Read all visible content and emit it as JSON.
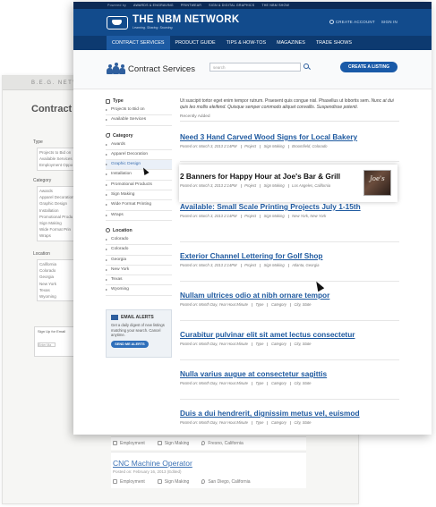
{
  "bg_page": {
    "header_text": "B.E.G. NETWORK",
    "title": "Contract Se",
    "type_label": "Type",
    "type_items": [
      "Projects to Bid on",
      "Available Services",
      "Employment Oppo"
    ],
    "category_label": "Category",
    "category_items": [
      "Awards",
      "Apparel Decoration",
      "Graphic Design",
      "Installation",
      "Promotional Produ",
      "Sign Making",
      "Wide Format Prin",
      "Wraps"
    ],
    "location_label": "Location",
    "location_items": [
      "California",
      "Colorado",
      "Georgia",
      "New York",
      "Texas",
      "Wyoming"
    ],
    "signup_title": "Sign Up for Email",
    "signup_placeholder": "Enter Ma",
    "listings": [
      {
        "meta_type": "Employment",
        "meta_category": "Sign Making",
        "meta_location": "Fresno, California"
      },
      {
        "title": "CNC Machine Operator",
        "posted": "Posted on: February 16, 2013 (Edited)",
        "meta_type": "Employment",
        "meta_category": "Sign Making",
        "meta_location": "San Diego, California"
      }
    ]
  },
  "top_bar": {
    "powered_by": "Powered by",
    "links": [
      "AWARDS & ENGRAVING",
      "PRINTWEAR",
      "SIGN & DIGITAL GRAPHICS",
      "THE NBM SHOW"
    ]
  },
  "brand": {
    "name": "THE NBM NETWORK",
    "tagline": "Learning. Sharing. Sourcing."
  },
  "account": {
    "create": "CREATE ACCOUNT",
    "signin": "SIGN IN"
  },
  "nav": [
    "CONTRACT SERVICES",
    "PRODUCT GUIDE",
    "TIPS & HOW-TOS",
    "MAGAZINES",
    "TRADE SHOWS"
  ],
  "section": {
    "title": "Contract Services",
    "search_placeholder": "search",
    "cta": "CREATE A LISTING"
  },
  "sidebar": {
    "type_label": "Type",
    "type_items": [
      "Projects to Bid on",
      "Available Services"
    ],
    "category_label": "Category",
    "category_items": [
      "Awards",
      "Apparel Decoration",
      "Graphic Design",
      "Installation",
      "Promotional Products",
      "Sign Making",
      "Wide Format Printing",
      "Wraps"
    ],
    "location_label": "Location",
    "location_items": [
      "Colorado",
      "Colorado",
      "Georgia",
      "New York",
      "Texas",
      "Wyoming"
    ]
  },
  "email_alerts": {
    "title": "EMAIL ALERTS",
    "body": "Get a daily digest of new listings matching your search. Cancel anytime.",
    "button": "SEND ME ALERTS"
  },
  "intro": {
    "text": "Ut suscipit tortor eget enim tempor rutrum. Praesent quis congue nisl. Phasellus ut lobortis sem.",
    "italic": "Nunc at dui quis leo mollis eleifend. Quisque semper commodo aliquet convallis. Suspendisse potenti."
  },
  "recently_added": "Recently Added",
  "listings": [
    {
      "title": "Need 3 Hand Carved Wood Signs for Local Bakery",
      "posted": "Posted on: March 3, 2013 2:14PM",
      "type": "Project",
      "category": "Sign Making",
      "location": "Broomfield, Colorado"
    },
    {
      "title": "2 Banners for Happy Hour at Joe's Bar & Grill",
      "posted": "Posted on: March 3, 2013 2:14PM",
      "type": "Project",
      "category": "Sign Making",
      "location": "Los Angeles, California",
      "thumb": "Joe's"
    },
    {
      "title": "Available: Small Scale Printing Projects July 1-15th",
      "posted": "Posted on: March 3, 2013 2:14PM",
      "type": "Project",
      "category": "Sign Making",
      "location": "New York, New York"
    },
    {
      "title": "Exterior Channel Lettering for Golf Shop",
      "posted": "Posted on: March 3, 2013 2:14PM",
      "type": "Project",
      "category": "Sign Making",
      "location": "Atlanta, Georgia"
    },
    {
      "title": "Nullam ultrices odio at nibh ornare tempor",
      "posted": "Posted on: Month Day, Year Hour:Minute",
      "type": "Type",
      "category": "Category",
      "location": "City, State"
    },
    {
      "title": "Curabitur pulvinar elit sit amet lectus consectetur",
      "posted": "Posted on: Month Day, Year Hour:Minute",
      "type": "Type",
      "category": "Category",
      "location": "City, State"
    },
    {
      "title": "Nulla varius augue at consectetur sagittis",
      "posted": "Posted on: Month Day, Year Hour:Minute",
      "type": "Type",
      "category": "Category",
      "location": "City, State"
    },
    {
      "title": "Duis a dui hendrerit, dignissim metus vel, euismod",
      "posted": "Posted on: Month Day, Year Hour:Minute",
      "type": "Type",
      "category": "Category",
      "location": "City, State"
    }
  ],
  "colors": {
    "brand_dark": "#0d3a70",
    "brand": "#124b8c",
    "link": "#1f5aa0"
  }
}
